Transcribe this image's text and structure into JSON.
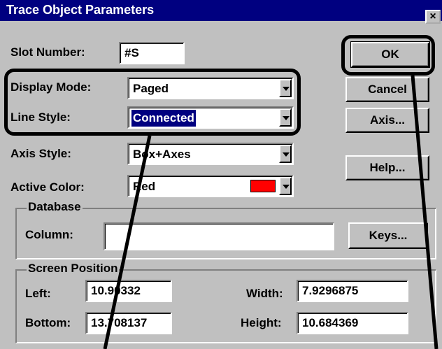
{
  "window": {
    "title": "Trace Object Parameters",
    "close_label": "×"
  },
  "labels": {
    "slot_number": "Slot Number:",
    "display_mode": "Display Mode:",
    "line_style": "Line Style:",
    "axis_style": "Axis Style:",
    "active_color": "Active Color:",
    "column": "Column:",
    "left": "Left:",
    "bottom": "Bottom:",
    "width": "Width:",
    "height": "Height:"
  },
  "groups": {
    "database": "Database",
    "screen_position": "Screen Position"
  },
  "fields": {
    "slot_number": "#S",
    "display_mode": "Paged",
    "line_style": "Connected",
    "axis_style": "Box+Axes",
    "active_color": "Red",
    "active_color_swatch": "#ff0000",
    "column": "",
    "left": "10.90332",
    "bottom": "13.708137",
    "width": "7.9296875",
    "height": "10.684369"
  },
  "buttons": {
    "ok": "OK",
    "cancel": "Cancel",
    "axis": "Axis...",
    "help": "Help...",
    "keys": "Keys..."
  },
  "colors": {
    "titlebar": "#000080",
    "face": "#c0c0c0",
    "selection": "#000080"
  }
}
